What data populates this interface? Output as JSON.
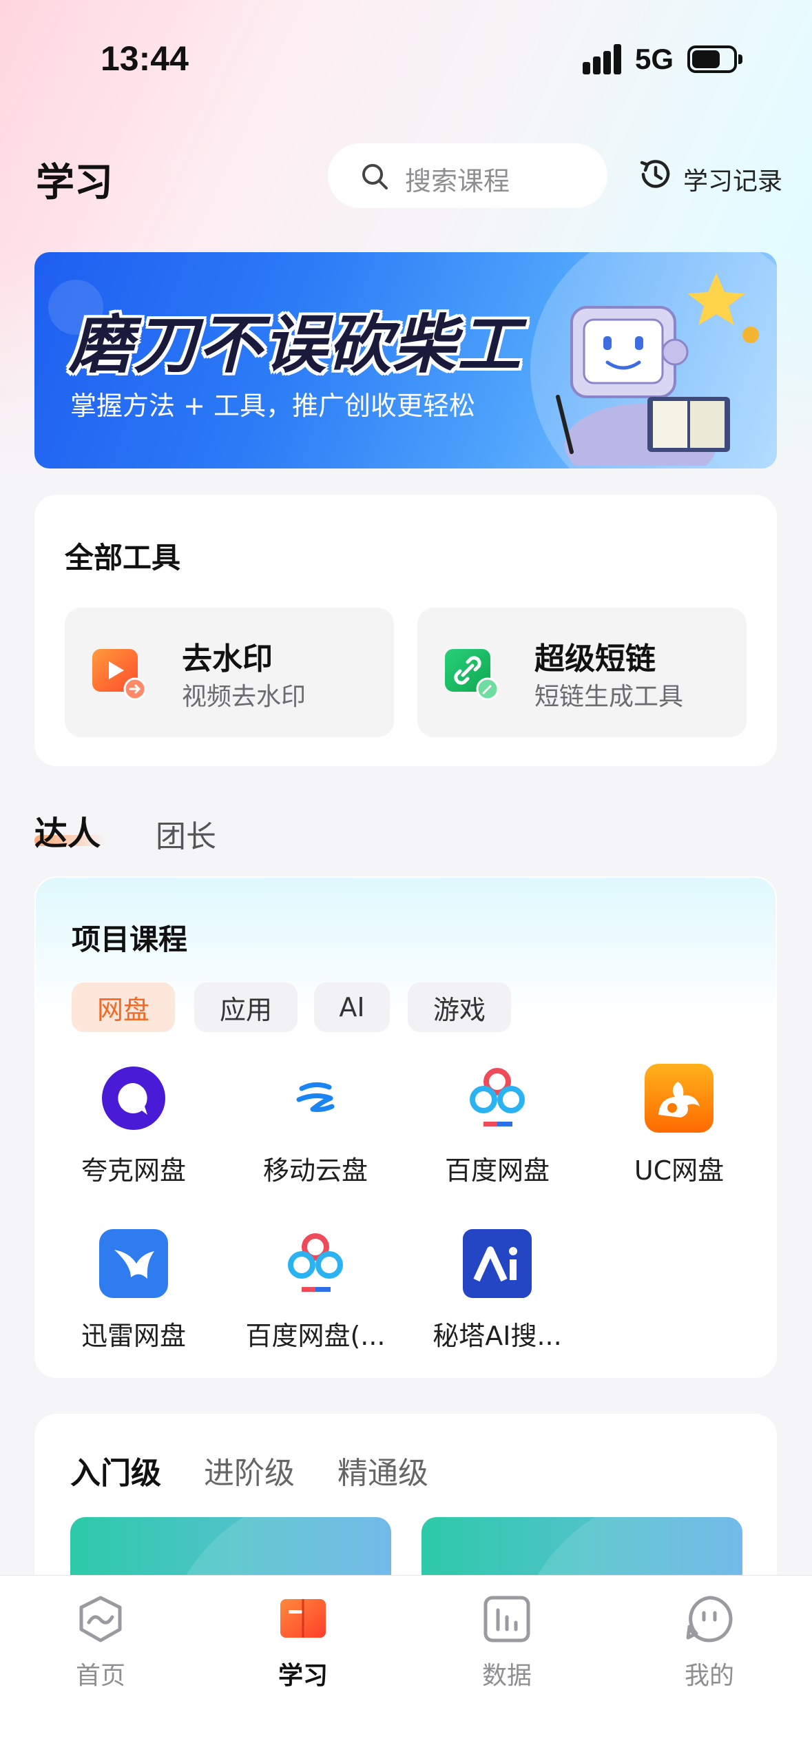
{
  "status_bar": {
    "time": "13:44",
    "network": "5G"
  },
  "header": {
    "title": "学习",
    "search_placeholder": "搜索课程",
    "history_label": "学习记录"
  },
  "banner": {
    "title": "磨刀不误砍柴工",
    "subtitle": "掌握方法 + 工具，推广创收更轻松"
  },
  "tools": {
    "title": "全部工具",
    "items": [
      {
        "name": "去水印",
        "desc": "视频去水印",
        "icon": "video-watermark-icon"
      },
      {
        "name": "超级短链",
        "desc": "短链生成工具",
        "icon": "short-link-icon"
      }
    ]
  },
  "role_tabs": [
    {
      "label": "达人",
      "active": true
    },
    {
      "label": "团长",
      "active": false
    }
  ],
  "projects": {
    "title": "项目课程",
    "chips": [
      {
        "label": "网盘",
        "active": true
      },
      {
        "label": "应用",
        "active": false
      },
      {
        "label": "AI",
        "active": false
      },
      {
        "label": "游戏",
        "active": false
      }
    ],
    "apps": [
      {
        "name": "夸克网盘",
        "icon": "quark-icon"
      },
      {
        "name": "移动云盘",
        "icon": "mobile-cloud-icon"
      },
      {
        "name": "百度网盘",
        "icon": "baidu-netdisk-icon"
      },
      {
        "name": "UC网盘",
        "icon": "uc-icon"
      },
      {
        "name": "迅雷网盘",
        "icon": "xunlei-icon"
      },
      {
        "name": "百度网盘(...",
        "icon": "baidu-netdisk-icon"
      },
      {
        "name": "秘塔AI搜...",
        "icon": "metaso-ai-icon"
      }
    ]
  },
  "levels": {
    "tabs": [
      {
        "label": "入门级",
        "active": true
      },
      {
        "label": "进阶级",
        "active": false
      },
      {
        "label": "精通级",
        "active": false
      }
    ]
  },
  "tabbar": [
    {
      "label": "首页",
      "icon": "home-icon",
      "active": false
    },
    {
      "label": "学习",
      "icon": "book-icon",
      "active": true
    },
    {
      "label": "数据",
      "icon": "chart-icon",
      "active": false
    },
    {
      "label": "我的",
      "icon": "profile-icon",
      "active": false
    }
  ],
  "colors": {
    "accent_orange": "#f06a2a",
    "banner_blue": "#2c7cf6",
    "chip_active_bg": "#fde6da"
  }
}
